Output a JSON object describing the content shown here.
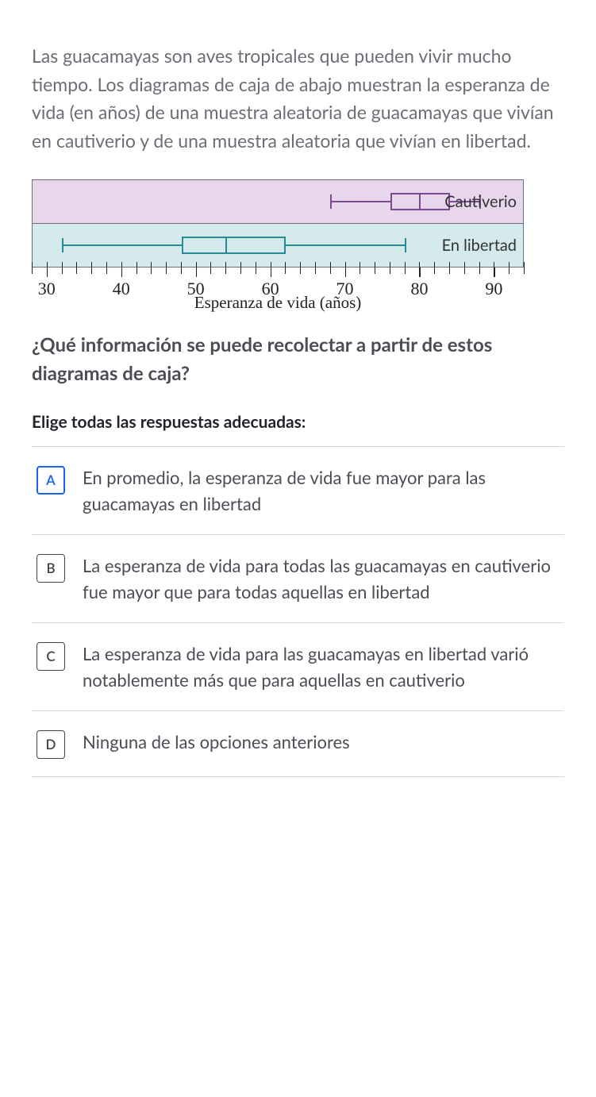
{
  "intro": "Las guacamayas son aves tropicales que pueden vivir mucho tiempo. Los diagramas de caja de abajo muestran la esperanza de vida (en años) de una muestra aleatoria de guacamayas que vivían en cautiverio y de una muestra aleatoria que vivían en libertad.",
  "question": "¿Qué información se puede recolectar a partir de estos diagramas de caja?",
  "instruction": "Elige todas las respuestas adecuadas:",
  "options": {
    "a": {
      "letter": "A",
      "text": "En promedio, la esperanza de vida fue mayor para las guacamayas en libertad",
      "selected": true
    },
    "b": {
      "letter": "B",
      "text": "La esperanza de vida para todas las guacamayas en cautiverio fue mayor que para todas aquellas en libertad",
      "selected": false
    },
    "c": {
      "letter": "C",
      "text": "La esperanza de vida para las guacamayas en libertad varió notablemente más que para aquellas en cautiverio",
      "selected": false
    },
    "d": {
      "letter": "D",
      "text": "Ninguna de las opciones anteriores",
      "selected": false
    }
  },
  "chart_data": {
    "type": "boxplot",
    "xlabel": "Esperanza de vida (años)",
    "xlim": [
      28,
      94
    ],
    "ticks_major": [
      30,
      40,
      50,
      60,
      70,
      80,
      90
    ],
    "series": [
      {
        "name": "Cautiverio",
        "min": 68,
        "q1": 76,
        "median": 80,
        "q3": 84,
        "max": 88,
        "color": "#7b4b91",
        "fill": "#e8d6ed"
      },
      {
        "name": "En libertad",
        "min": 32,
        "q1": 48,
        "median": 54,
        "q3": 62,
        "max": 78,
        "color": "#2a8a93",
        "fill": "#d4eaed"
      }
    ]
  }
}
